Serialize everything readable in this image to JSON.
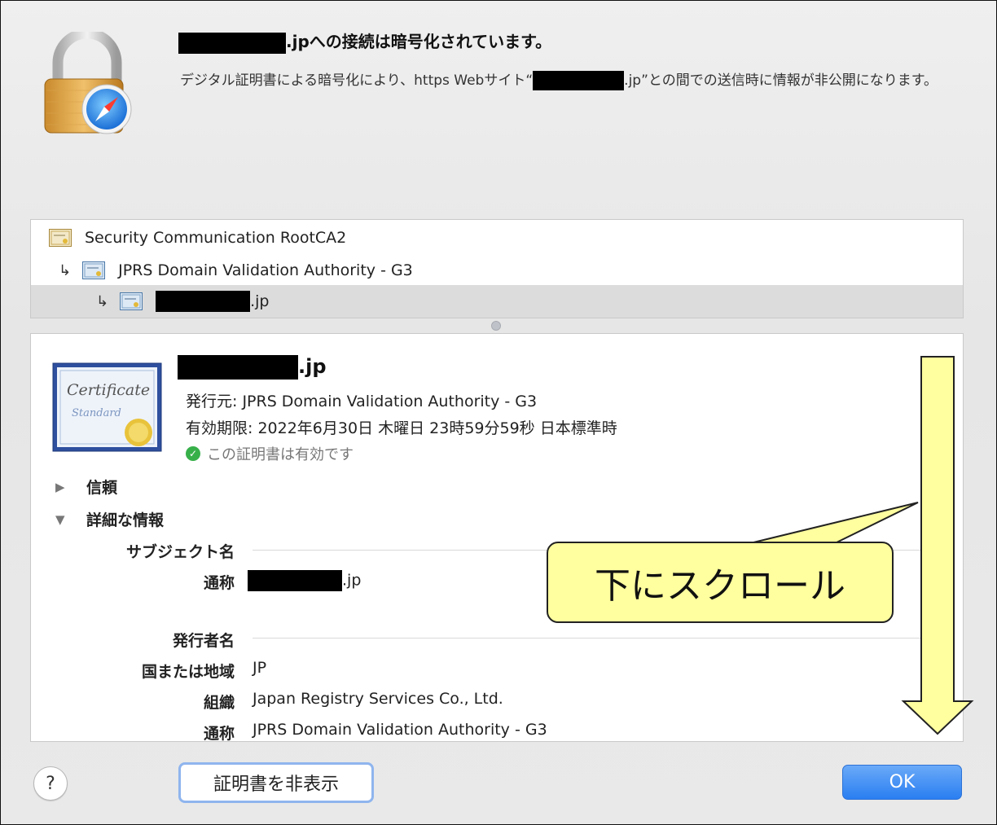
{
  "header": {
    "title_suffix": ".jpへの接続は暗号化されています。",
    "desc_part1": "デジタル証明書による暗号化により、https Webサイト“",
    "desc_part2": ".jp”との間での送信時に情報が非公開になります。"
  },
  "chain": {
    "root": "Security Communication RootCA2",
    "intermediate": "JPRS Domain Validation Authority - G3",
    "leaf_suffix": ".jp",
    "arrow": "↳"
  },
  "detail": {
    "name_suffix": ".jp",
    "issuer": "発行元: JPRS Domain Validation Authority - G3",
    "expiry": "有効期限: 2022年6月30日 木曜日 23時59分59秒 日本標準時",
    "valid": "この証明書は有効です",
    "check_glyph": "✓",
    "trust": "信頼",
    "details": "詳細な情報",
    "subject_heading": "サブジェクト名",
    "common_name_label": "通称",
    "common_name_suffix": ".jp",
    "issuer_heading": "発行者名",
    "country_label": "国または地域",
    "country_value": "JP",
    "org_label": "組織",
    "org_value": "Japan Registry Services Co., Ltd.",
    "issuer_cn_label": "通称",
    "issuer_cn_value": "JPRS Domain Validation Authority - G3"
  },
  "annotation": {
    "callout_text": "下にスクロール"
  },
  "buttons": {
    "help": "?",
    "hide_certificate": "証明書を非表示",
    "ok": "OK"
  },
  "big_cert": {
    "line1": "Certificate",
    "line2": "Standard"
  },
  "colors": {
    "ok_blue": "#2a7ef1",
    "callout_yellow": "#ffff9f",
    "valid_green": "#37b04a",
    "selected_row": "#dcdcdc"
  },
  "icons": {
    "lock": "padlock-safari-icon",
    "certificate": "certificate-icon",
    "valid": "checkmark-circle-icon",
    "collapsed": "disclosure-triangle-right-icon",
    "expanded": "disclosure-triangle-down-icon"
  }
}
